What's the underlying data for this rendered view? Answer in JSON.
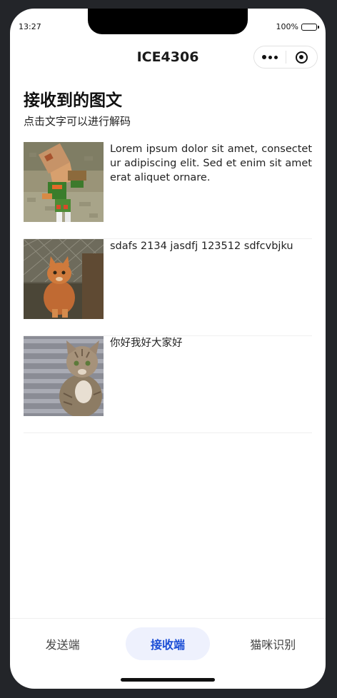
{
  "status_bar": {
    "time": "13:27",
    "battery": "100%"
  },
  "nav": {
    "title": "ICE4306"
  },
  "page": {
    "title": "接收到的图文",
    "subtitle": "点击文字可以进行解码"
  },
  "messages": [
    {
      "image": "minecraft-figure-image",
      "text": "Lorem ipsum dolor sit amet, consectetur adipiscing elit. Sed et enim sit amet erat aliquet ornare."
    },
    {
      "image": "orange-cat-image",
      "text": "sdafs 2134 jasdfj 123512 sdfcvbjku"
    },
    {
      "image": "tabby-cat-image",
      "text": "你好我好大家好"
    }
  ],
  "tabbar": {
    "tabs": [
      {
        "label": "发送端",
        "active": false
      },
      {
        "label": "接收端",
        "active": true
      },
      {
        "label": "猫咪识别",
        "active": false
      }
    ],
    "active_color": "#1d4fd6",
    "active_bg": "#eef1fd"
  },
  "icons": {
    "capsule_more": "more-dots-icon",
    "capsule_close": "target-close-icon",
    "battery": "battery-icon"
  }
}
